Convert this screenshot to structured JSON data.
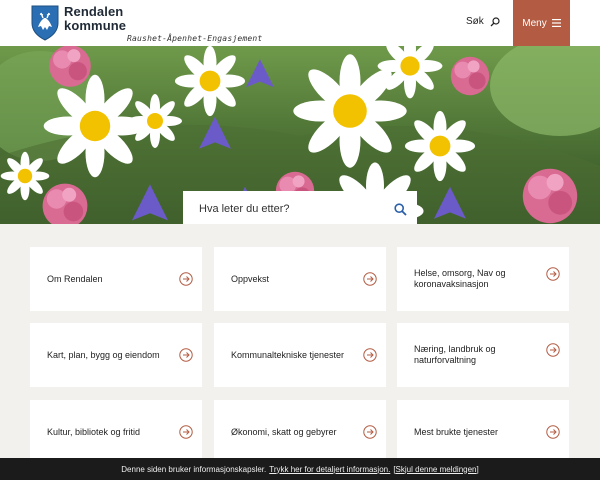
{
  "header": {
    "brand_line1": "Rendalen",
    "brand_line2": "kommune",
    "tagline": "Raushet-Åpenhet-Engasjement",
    "search_label": "Søk",
    "menu_label": "Meny"
  },
  "hero": {
    "search_placeholder": "Hva leter du etter?"
  },
  "cards": [
    {
      "label": "Om Rendalen"
    },
    {
      "label": "Oppvekst"
    },
    {
      "label": "Helse, omsorg, Nav og koronavaksinasjon"
    },
    {
      "label": "Kart, plan, bygg og eiendom"
    },
    {
      "label": "Kommunaltekniske tjenester"
    },
    {
      "label": "Næring, landbruk og naturforvaltning"
    },
    {
      "label": "Kultur, bibliotek og fritid"
    },
    {
      "label": "Økonomi, skatt og gebyrer"
    },
    {
      "label": "Mest brukte tjenester"
    }
  ],
  "cookie": {
    "text": "Denne siden bruker informasjonskapsler.",
    "details_link": "Trykk her for detaljert informasjon.",
    "hide_link": "[Skjul denne meldingen]"
  },
  "colors": {
    "accent": "#b35c43",
    "background": "#f3f1ee",
    "crest_blue": "#2a6fb3",
    "cookie_bar": "#1b1b1b"
  },
  "icons": {
    "crest": "coat-of-arms-icon",
    "search": "magnifier-icon",
    "menu": "hamburger-icon",
    "card_arrow": "circled-arrow-right-icon"
  }
}
